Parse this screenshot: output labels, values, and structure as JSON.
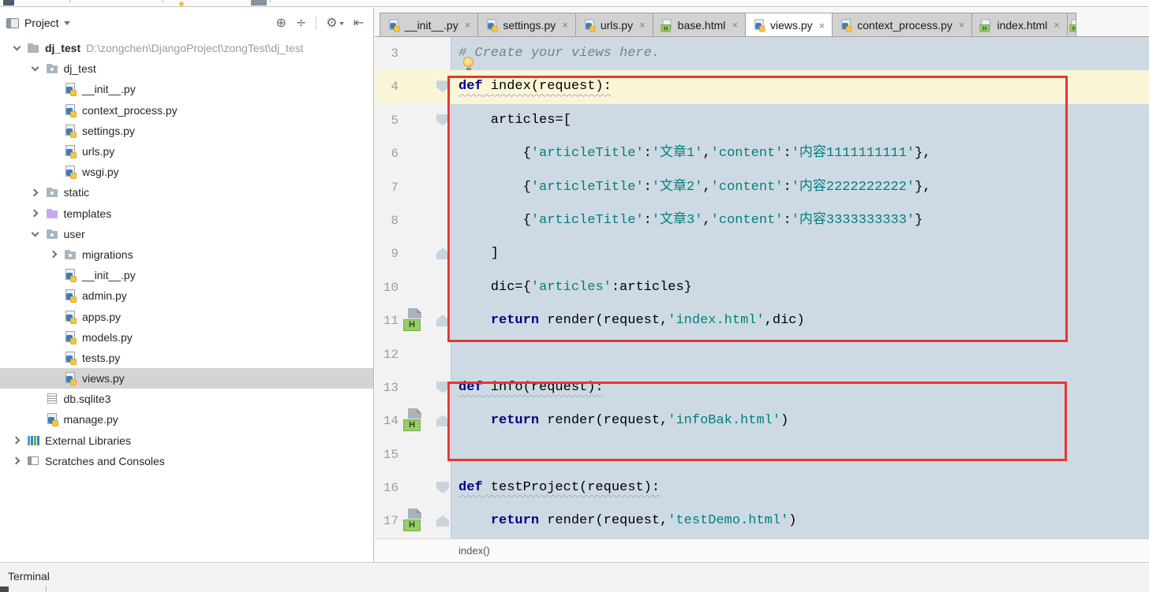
{
  "colors": {
    "annotation_red": "#e43733",
    "editor_bg": "#cedae3",
    "caret_line_bg": "#fbf5d8",
    "keyword": "#000080",
    "string": "#008080",
    "comment": "#808080",
    "selected_row_bg": "#d4d4d4"
  },
  "topstrip": {
    "fragments": [
      "/",
      "/",
      "/"
    ]
  },
  "project_panel": {
    "title": "Project",
    "dropdown_glyph": "▾",
    "header_icons": [
      {
        "name": "locate-icon",
        "glyph": "⊕"
      },
      {
        "name": "collapse-all-icon",
        "glyph": "÷"
      },
      {
        "name": "settings-gear-icon",
        "glyph": "⚙"
      },
      {
        "name": "hide-panel-icon",
        "glyph": "⇤"
      }
    ],
    "tree": [
      {
        "label": "dj_test",
        "path": "D:\\zongchen\\DjangoProject\\zongTest\\dj_test",
        "indent": 0,
        "chevron": "expanded",
        "icon": "folder",
        "bold": true
      },
      {
        "label": "dj_test",
        "indent": 1,
        "chevron": "expanded",
        "icon": "folder-pkg"
      },
      {
        "label": "__init__.py",
        "indent": 2,
        "icon": "python"
      },
      {
        "label": "context_process.py",
        "indent": 2,
        "icon": "python"
      },
      {
        "label": "settings.py",
        "indent": 2,
        "icon": "python"
      },
      {
        "label": "urls.py",
        "indent": 2,
        "icon": "python"
      },
      {
        "label": "wsgi.py",
        "indent": 2,
        "icon": "python"
      },
      {
        "label": "static",
        "indent": 1,
        "chevron": "collapsed",
        "icon": "folder-pkg"
      },
      {
        "label": "templates",
        "indent": 1,
        "chevron": "collapsed",
        "icon": "folder-tpl"
      },
      {
        "label": "user",
        "indent": 1,
        "chevron": "expanded",
        "icon": "folder-pkg"
      },
      {
        "label": "migrations",
        "indent": 2,
        "chevron": "collapsed",
        "icon": "folder-pkg"
      },
      {
        "label": "__init__.py",
        "indent": 2,
        "icon": "python"
      },
      {
        "label": "admin.py",
        "indent": 2,
        "icon": "python"
      },
      {
        "label": "apps.py",
        "indent": 2,
        "icon": "python"
      },
      {
        "label": "models.py",
        "indent": 2,
        "icon": "python"
      },
      {
        "label": "tests.py",
        "indent": 2,
        "icon": "python"
      },
      {
        "label": "views.py",
        "indent": 2,
        "icon": "python",
        "selected": true
      },
      {
        "label": "db.sqlite3",
        "indent": 1,
        "icon": "sqlite"
      },
      {
        "label": "manage.py",
        "indent": 1,
        "icon": "python"
      },
      {
        "label": "External Libraries",
        "indent": 0,
        "chevron": "collapsed",
        "icon": "libs"
      },
      {
        "label": "Scratches and Consoles",
        "indent": 0,
        "chevron": "collapsed",
        "icon": "scratches"
      }
    ]
  },
  "editor": {
    "close_glyph": "×",
    "html_badge_letter": "H",
    "tabs": [
      {
        "label": "__init__.py",
        "icon": "python",
        "active": false
      },
      {
        "label": "settings.py",
        "icon": "python",
        "active": false
      },
      {
        "label": "urls.py",
        "icon": "python",
        "active": false
      },
      {
        "label": "base.html",
        "icon": "html",
        "active": false
      },
      {
        "label": "views.py",
        "icon": "python",
        "active": true
      },
      {
        "label": "context_process.py",
        "icon": "python",
        "active": false
      },
      {
        "label": "index.html",
        "icon": "html",
        "active": false
      }
    ],
    "code_lines": [
      {
        "n": 3,
        "bulb": true,
        "segs": [
          {
            "t": "# Create your views here.",
            "c": "com"
          }
        ]
      },
      {
        "n": 4,
        "caret": true,
        "wave": true,
        "fold": "down",
        "segs": [
          {
            "t": "def",
            "c": "kw"
          },
          {
            "t": " index(request):",
            "c": "pl"
          }
        ]
      },
      {
        "n": 5,
        "fold": "down",
        "segs": [
          {
            "t": "    articles=[",
            "c": "pl"
          }
        ]
      },
      {
        "n": 6,
        "segs": [
          {
            "t": "        {",
            "c": "pl"
          },
          {
            "t": "'articleTitle'",
            "c": "str"
          },
          {
            "t": ":",
            "c": "pl"
          },
          {
            "t": "'文章1'",
            "c": "str"
          },
          {
            "t": ",",
            "c": "pl"
          },
          {
            "t": "'content'",
            "c": "str"
          },
          {
            "t": ":",
            "c": "pl"
          },
          {
            "t": "'内容1111111111'",
            "c": "str"
          },
          {
            "t": "},",
            "c": "pl"
          }
        ]
      },
      {
        "n": 7,
        "segs": [
          {
            "t": "        {",
            "c": "pl"
          },
          {
            "t": "'articleTitle'",
            "c": "str"
          },
          {
            "t": ":",
            "c": "pl"
          },
          {
            "t": "'文章2'",
            "c": "str"
          },
          {
            "t": ",",
            "c": "pl"
          },
          {
            "t": "'content'",
            "c": "str"
          },
          {
            "t": ":",
            "c": "pl"
          },
          {
            "t": "'内容2222222222'",
            "c": "str"
          },
          {
            "t": "},",
            "c": "pl"
          }
        ]
      },
      {
        "n": 8,
        "segs": [
          {
            "t": "        {",
            "c": "pl"
          },
          {
            "t": "'articleTitle'",
            "c": "str"
          },
          {
            "t": ":",
            "c": "pl"
          },
          {
            "t": "'文章3'",
            "c": "str"
          },
          {
            "t": ",",
            "c": "pl"
          },
          {
            "t": "'content'",
            "c": "str"
          },
          {
            "t": ":",
            "c": "pl"
          },
          {
            "t": "'内容3333333333'",
            "c": "str"
          },
          {
            "t": "}",
            "c": "pl"
          }
        ]
      },
      {
        "n": 9,
        "fold": "up",
        "segs": [
          {
            "t": "    ]",
            "c": "pl"
          }
        ]
      },
      {
        "n": 10,
        "segs": [
          {
            "t": "    dic={",
            "c": "pl"
          },
          {
            "t": "'articles'",
            "c": "str"
          },
          {
            "t": ":articles}",
            "c": "pl"
          }
        ]
      },
      {
        "n": 11,
        "fold": "up",
        "gutter_icon": "html",
        "segs": [
          {
            "t": "    ",
            "c": "pl"
          },
          {
            "t": "return",
            "c": "kw"
          },
          {
            "t": " render(request,",
            "c": "pl"
          },
          {
            "t": "'index.html'",
            "c": "str"
          },
          {
            "t": ",dic)",
            "c": "pl"
          }
        ]
      },
      {
        "n": 12,
        "segs": []
      },
      {
        "n": 13,
        "wave": true,
        "fold": "down",
        "segs": [
          {
            "t": "def",
            "c": "kw"
          },
          {
            "t": " info(request):",
            "c": "pl"
          }
        ]
      },
      {
        "n": 14,
        "fold": "up",
        "gutter_icon": "html",
        "segs": [
          {
            "t": "    ",
            "c": "pl"
          },
          {
            "t": "return",
            "c": "kw"
          },
          {
            "t": " render(request,",
            "c": "pl"
          },
          {
            "t": "'infoBak.html'",
            "c": "str"
          },
          {
            "t": ")",
            "c": "pl"
          }
        ]
      },
      {
        "n": 15,
        "segs": []
      },
      {
        "n": 16,
        "wave": true,
        "fold": "down",
        "segs": [
          {
            "t": "def",
            "c": "kw"
          },
          {
            "t": " testProject(request):",
            "c": "pl"
          }
        ]
      },
      {
        "n": 17,
        "fold": "up",
        "gutter_icon": "html",
        "segs": [
          {
            "t": "    ",
            "c": "pl"
          },
          {
            "t": "return",
            "c": "kw"
          },
          {
            "t": " render(request,",
            "c": "pl"
          },
          {
            "t": "'testDemo.html'",
            "c": "str"
          },
          {
            "t": ")",
            "c": "pl"
          }
        ]
      }
    ],
    "breadcrumb": "index()"
  },
  "terminal": {
    "label": "Terminal"
  }
}
